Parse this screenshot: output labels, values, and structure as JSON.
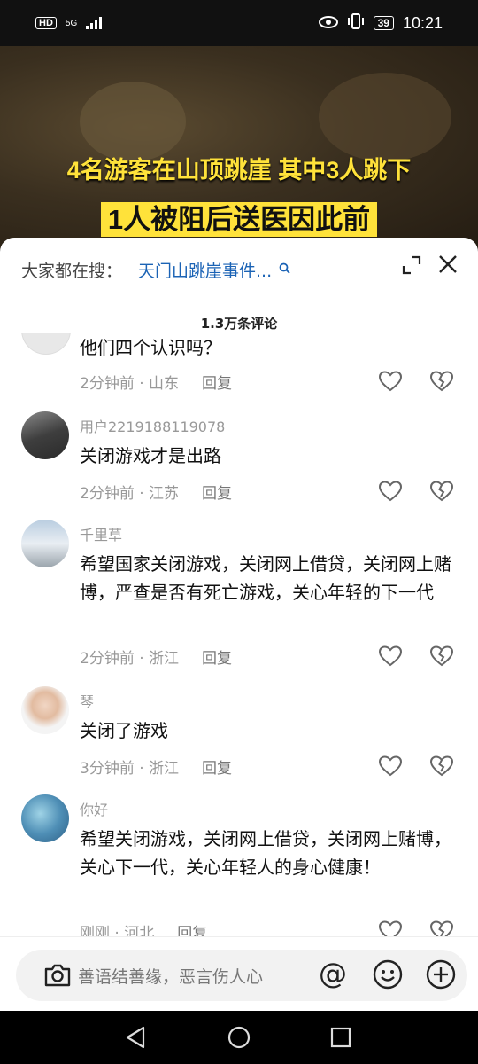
{
  "status_bar": {
    "hd": "HD",
    "network": "5G",
    "battery": "39",
    "time": "10:21"
  },
  "video": {
    "caption_line1": "4名游客在山顶跳崖 其中3人跳下",
    "caption_line2": "1人被阻后送医因此前"
  },
  "search": {
    "label": "大家都在搜：",
    "term": "天门山跳崖事件..."
  },
  "comment_count": "1.3万条评论",
  "comments": [
    {
      "name": "",
      "text": "他们四个认识吗？",
      "time": "2分钟前 · 山东",
      "reply": "回复"
    },
    {
      "name": "用户2219188119078",
      "text": "关闭游戏才是出路",
      "time": "2分钟前 · 江苏",
      "reply": "回复"
    },
    {
      "name": "千里草",
      "text": "希望国家关闭游戏，关闭网上借贷，关闭网上赌博，严查是否有死亡游戏，关心年轻的下一代",
      "time": "2分钟前 · 浙江",
      "reply": "回复"
    },
    {
      "name": "琴",
      "text": "关闭了游戏",
      "time": "3分钟前 · 浙江",
      "reply": "回复"
    },
    {
      "name": "你好",
      "text": "希望关闭游戏，关闭网上借贷，关闭网上赌博，关心下一代，关心年轻人的身心健康！",
      "time": "刚刚 · 河北",
      "reply": "回复"
    }
  ],
  "input": {
    "placeholder": "善语结善缘，恶言伤人心",
    "at": "@"
  }
}
